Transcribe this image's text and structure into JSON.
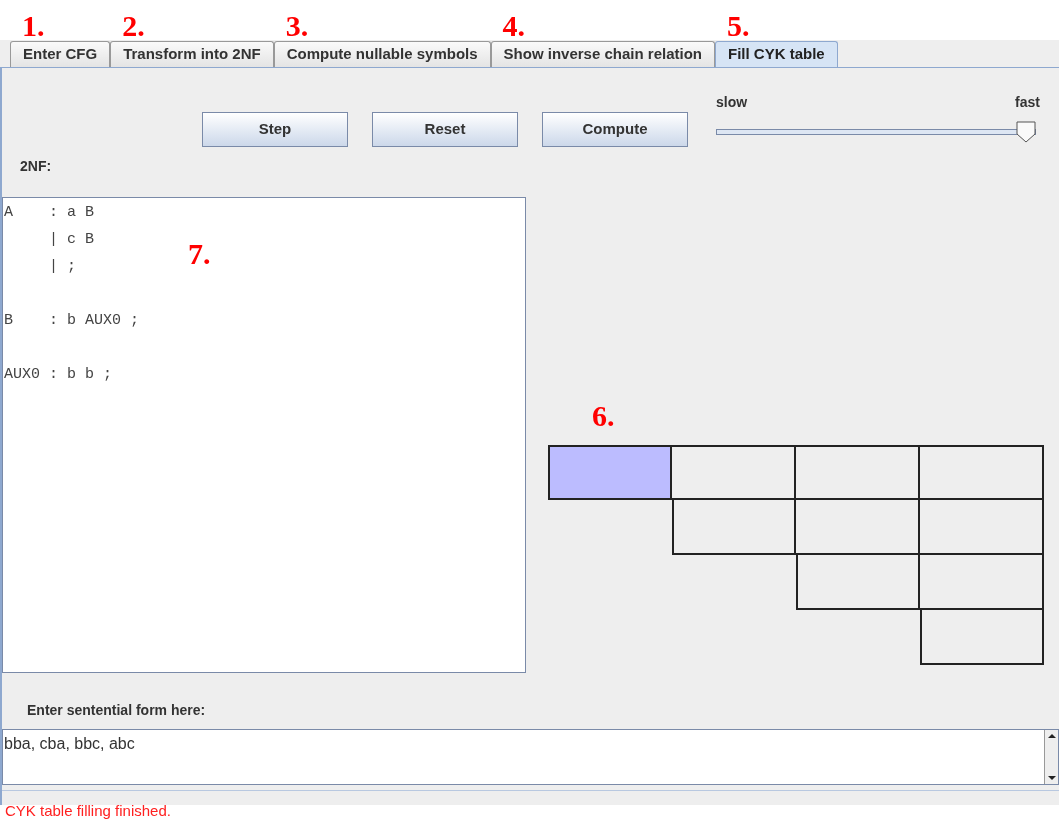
{
  "tabs": [
    {
      "label": "Enter CFG",
      "marker": "1.",
      "selected": false
    },
    {
      "label": "Transform into 2NF",
      "marker": "2.",
      "selected": false
    },
    {
      "label": "Compute nullable symbols",
      "marker": "3.",
      "selected": false
    },
    {
      "label": "Show inverse chain relation",
      "marker": "4.",
      "selected": false
    },
    {
      "label": "Fill CYK table",
      "marker": "5.",
      "selected": true
    }
  ],
  "buttons": [
    "Step",
    "Reset",
    "Compute"
  ],
  "speed_slider": {
    "min_label": "slow",
    "max_label": "fast",
    "level": 1
  },
  "grammar": {
    "label": "2NF:",
    "marker": "7.",
    "text": "A    : a B\n     | c B\n     | ;\n\nB    : b AUX0 ;\n\nAUX0 : b b ;"
  },
  "cyk_table": {
    "marker": "6.",
    "rows": [
      {
        "cells": [
          {
            "highlighted": true
          },
          {
            "highlighted": false
          },
          {
            "highlighted": false
          },
          {
            "highlighted": false
          }
        ]
      },
      {
        "cells": [
          {
            "highlighted": false
          },
          {
            "highlighted": false
          },
          {
            "highlighted": false
          }
        ]
      },
      {
        "cells": [
          {
            "highlighted": false
          },
          {
            "highlighted": false
          }
        ]
      },
      {
        "cells": [
          {
            "highlighted": false
          }
        ]
      }
    ]
  },
  "input": {
    "label": "Enter sentential form here:",
    "value": "bba, cba, bbc, abc"
  },
  "status_bar": {
    "text": "CYK table filling finished."
  }
}
